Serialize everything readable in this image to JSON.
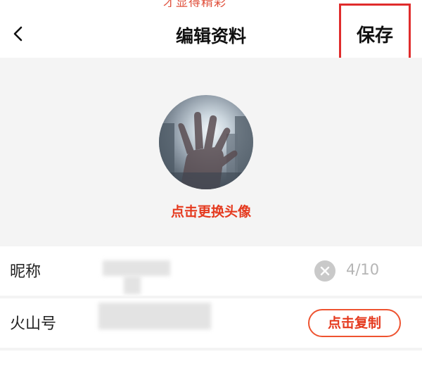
{
  "top_banner": {
    "text": "才显得精彩"
  },
  "header": {
    "title": "编辑资料",
    "save_label": "保存",
    "back_icon": "chevron-left-icon"
  },
  "avatar_section": {
    "change_avatar_label": "点击更换头像"
  },
  "fields": {
    "nickname": {
      "label": "昵称",
      "counter": "4/10",
      "clear_icon": "clear-circle-icon"
    },
    "huoshan_id": {
      "label": "火山号",
      "copy_label": "点击复制"
    }
  },
  "colors": {
    "accent": "#e53a1f",
    "highlight_box": "#e02c2c",
    "section_bg": "#f4f4f4"
  }
}
